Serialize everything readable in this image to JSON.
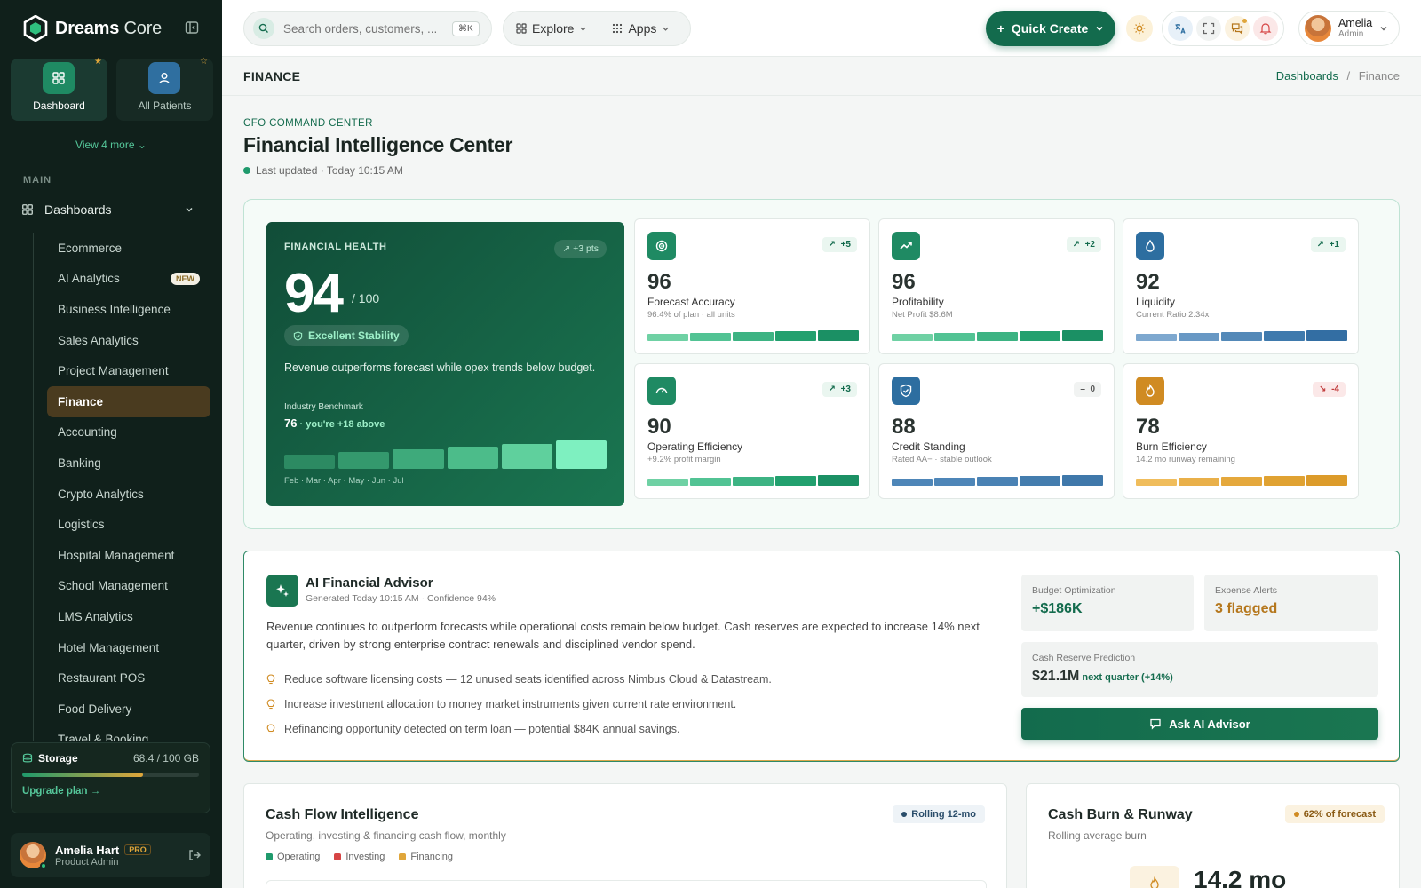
{
  "brand": {
    "name_bold": "Dreams",
    "name_light": " Core"
  },
  "quick_tiles": [
    {
      "label": "Dashboard",
      "icon": "grid-icon",
      "active": true
    },
    {
      "label": "All Patients",
      "icon": "user-icon",
      "active": false
    }
  ],
  "sidebar": {
    "view_more": "View 4 more",
    "section_label": "MAIN",
    "dashboards_label": "Dashboards",
    "items": [
      {
        "label": "Ecommerce"
      },
      {
        "label": "AI Analytics",
        "badge": "NEW"
      },
      {
        "label": "Business Intelligence"
      },
      {
        "label": "Sales Analytics"
      },
      {
        "label": "Project Management"
      },
      {
        "label": "Finance",
        "active": true
      },
      {
        "label": "Accounting"
      },
      {
        "label": "Banking"
      },
      {
        "label": "Crypto Analytics"
      },
      {
        "label": "Logistics"
      },
      {
        "label": "Hospital Management"
      },
      {
        "label": "School Management"
      },
      {
        "label": "LMS Analytics"
      },
      {
        "label": "Hotel Management"
      },
      {
        "label": "Restaurant POS"
      },
      {
        "label": "Food Delivery"
      },
      {
        "label": "Travel & Booking"
      }
    ],
    "storage": {
      "label": "Storage",
      "value": "68.4 / 100 GB",
      "fraction": 0.684,
      "upgrade": "Upgrade plan"
    },
    "user": {
      "name": "Amelia Hart",
      "badge": "PRO",
      "role": "Product Admin"
    }
  },
  "topbar": {
    "search_placeholder": "Search orders, customers, ...",
    "shortcut": "⌘K",
    "explore": "Explore",
    "apps": "Apps",
    "quick_create": "Quick Create",
    "profile_name": "Amelia",
    "profile_role": "Admin"
  },
  "pagebar": {
    "title": "FINANCE",
    "crumb1": "Dashboards",
    "sep": "/",
    "crumb2": "Finance"
  },
  "header": {
    "eyebrow": "CFO COMMAND CENTER",
    "title": "Financial Intelligence Center",
    "updated": "Last updated · Today 10:15 AM"
  },
  "health": {
    "label": "FINANCIAL HEALTH",
    "delta": "+3 pts",
    "score": "94",
    "out_of": "/ 100",
    "badge": "Excellent Stability",
    "description": "Revenue outperforms forecast while opex trends below budget.",
    "benchmark_label": "Industry Benchmark",
    "benchmark_value": "76",
    "benchmark_note": " · you're +18 above",
    "months": "Feb · Mar · Apr · May · Jun · Jul",
    "trend_levels": [
      0.5,
      0.6,
      0.7,
      0.78,
      0.88,
      1.0
    ]
  },
  "kpis": [
    {
      "value": "96",
      "name": "Forecast Accuracy",
      "sub": "96.4% of plan · all units",
      "delta": "+5",
      "trend": "up",
      "icon": "target-icon",
      "color": "#1f8a63",
      "bar_colors": [
        "#6fd1a4",
        "#52c394",
        "#3db383",
        "#22a06e",
        "#1b9064"
      ]
    },
    {
      "value": "96",
      "name": "Profitability",
      "sub": "Net Profit $8.6M",
      "delta": "+2",
      "trend": "up",
      "icon": "trend-up-icon",
      "color": "#1f8a63",
      "bar_colors": [
        "#6fd1a4",
        "#52c394",
        "#3db383",
        "#22a06e",
        "#1b9064"
      ]
    },
    {
      "value": "92",
      "name": "Liquidity",
      "sub": "Current Ratio 2.34x",
      "delta": "+1",
      "trend": "up",
      "icon": "droplet-icon",
      "color": "#2d6ea0",
      "bar_colors": [
        "#7ea8cf",
        "#6898c4",
        "#5489b8",
        "#3f7aad",
        "#336ea3"
      ]
    },
    {
      "value": "90",
      "name": "Operating Efficiency",
      "sub": "+9.2% profit margin",
      "delta": "+3",
      "trend": "up",
      "icon": "gauge-icon",
      "color": "#1f8a63",
      "bar_colors": [
        "#6fd1a4",
        "#52c394",
        "#3db383",
        "#22a06e",
        "#1b9064"
      ]
    },
    {
      "value": "88",
      "name": "Credit Standing",
      "sub": "Rated AA− · stable outlook",
      "delta": "0",
      "trend": "flat",
      "icon": "shield-icon",
      "color": "#2d6ea0",
      "bar_colors": [
        "#4e86b8",
        "#4e86b8",
        "#4a82b4",
        "#447dae",
        "#3f78aa"
      ]
    },
    {
      "value": "78",
      "name": "Burn Efficiency",
      "sub": "14.2 mo runway remaining",
      "delta": "-4",
      "trend": "down",
      "icon": "flame-icon",
      "color": "#d08b22",
      "bar_colors": [
        "#f0bd5c",
        "#e9b04a",
        "#e5a83c",
        "#e0a232",
        "#dc9b2a"
      ]
    }
  ],
  "advisor": {
    "title": "AI Financial Advisor",
    "generated": "Generated Today 10:15 AM · Confidence 94%",
    "body": "Revenue continues to outperform forecasts while operational costs remain below budget. Cash reserves are expected to increase 14% next quarter, driven by strong enterprise contract renewals and disciplined vendor spend.",
    "tips": [
      "Reduce software licensing costs — 12 unused seats identified across Nimbus Cloud & Datastream.",
      "Increase investment allocation to money market instruments given current rate environment.",
      "Refinancing opportunity detected on term loan — potential $84K annual savings."
    ],
    "budget_label": "Budget Optimization",
    "budget_value": "+$186K",
    "alerts_label": "Expense Alerts",
    "alerts_value": "3 flagged",
    "reserve_label": "Cash Reserve Prediction",
    "reserve_value": "$21.1M",
    "reserve_note": " next quarter (+14%)",
    "ask_button": "Ask AI Advisor"
  },
  "cashflow": {
    "title": "Cash Flow Intelligence",
    "subtitle": "Operating, investing & financing cash flow, monthly",
    "pill": "Rolling 12-mo",
    "legend": [
      {
        "label": "Operating",
        "color": "#1f9a6c"
      },
      {
        "label": "Investing",
        "color": "#d64545"
      },
      {
        "label": "Financing",
        "color": "#e0a63a"
      }
    ]
  },
  "burn": {
    "title": "Cash Burn & Runway",
    "subtitle": "Rolling average burn",
    "pill": "62% of forecast",
    "big": "14.2 mo"
  }
}
